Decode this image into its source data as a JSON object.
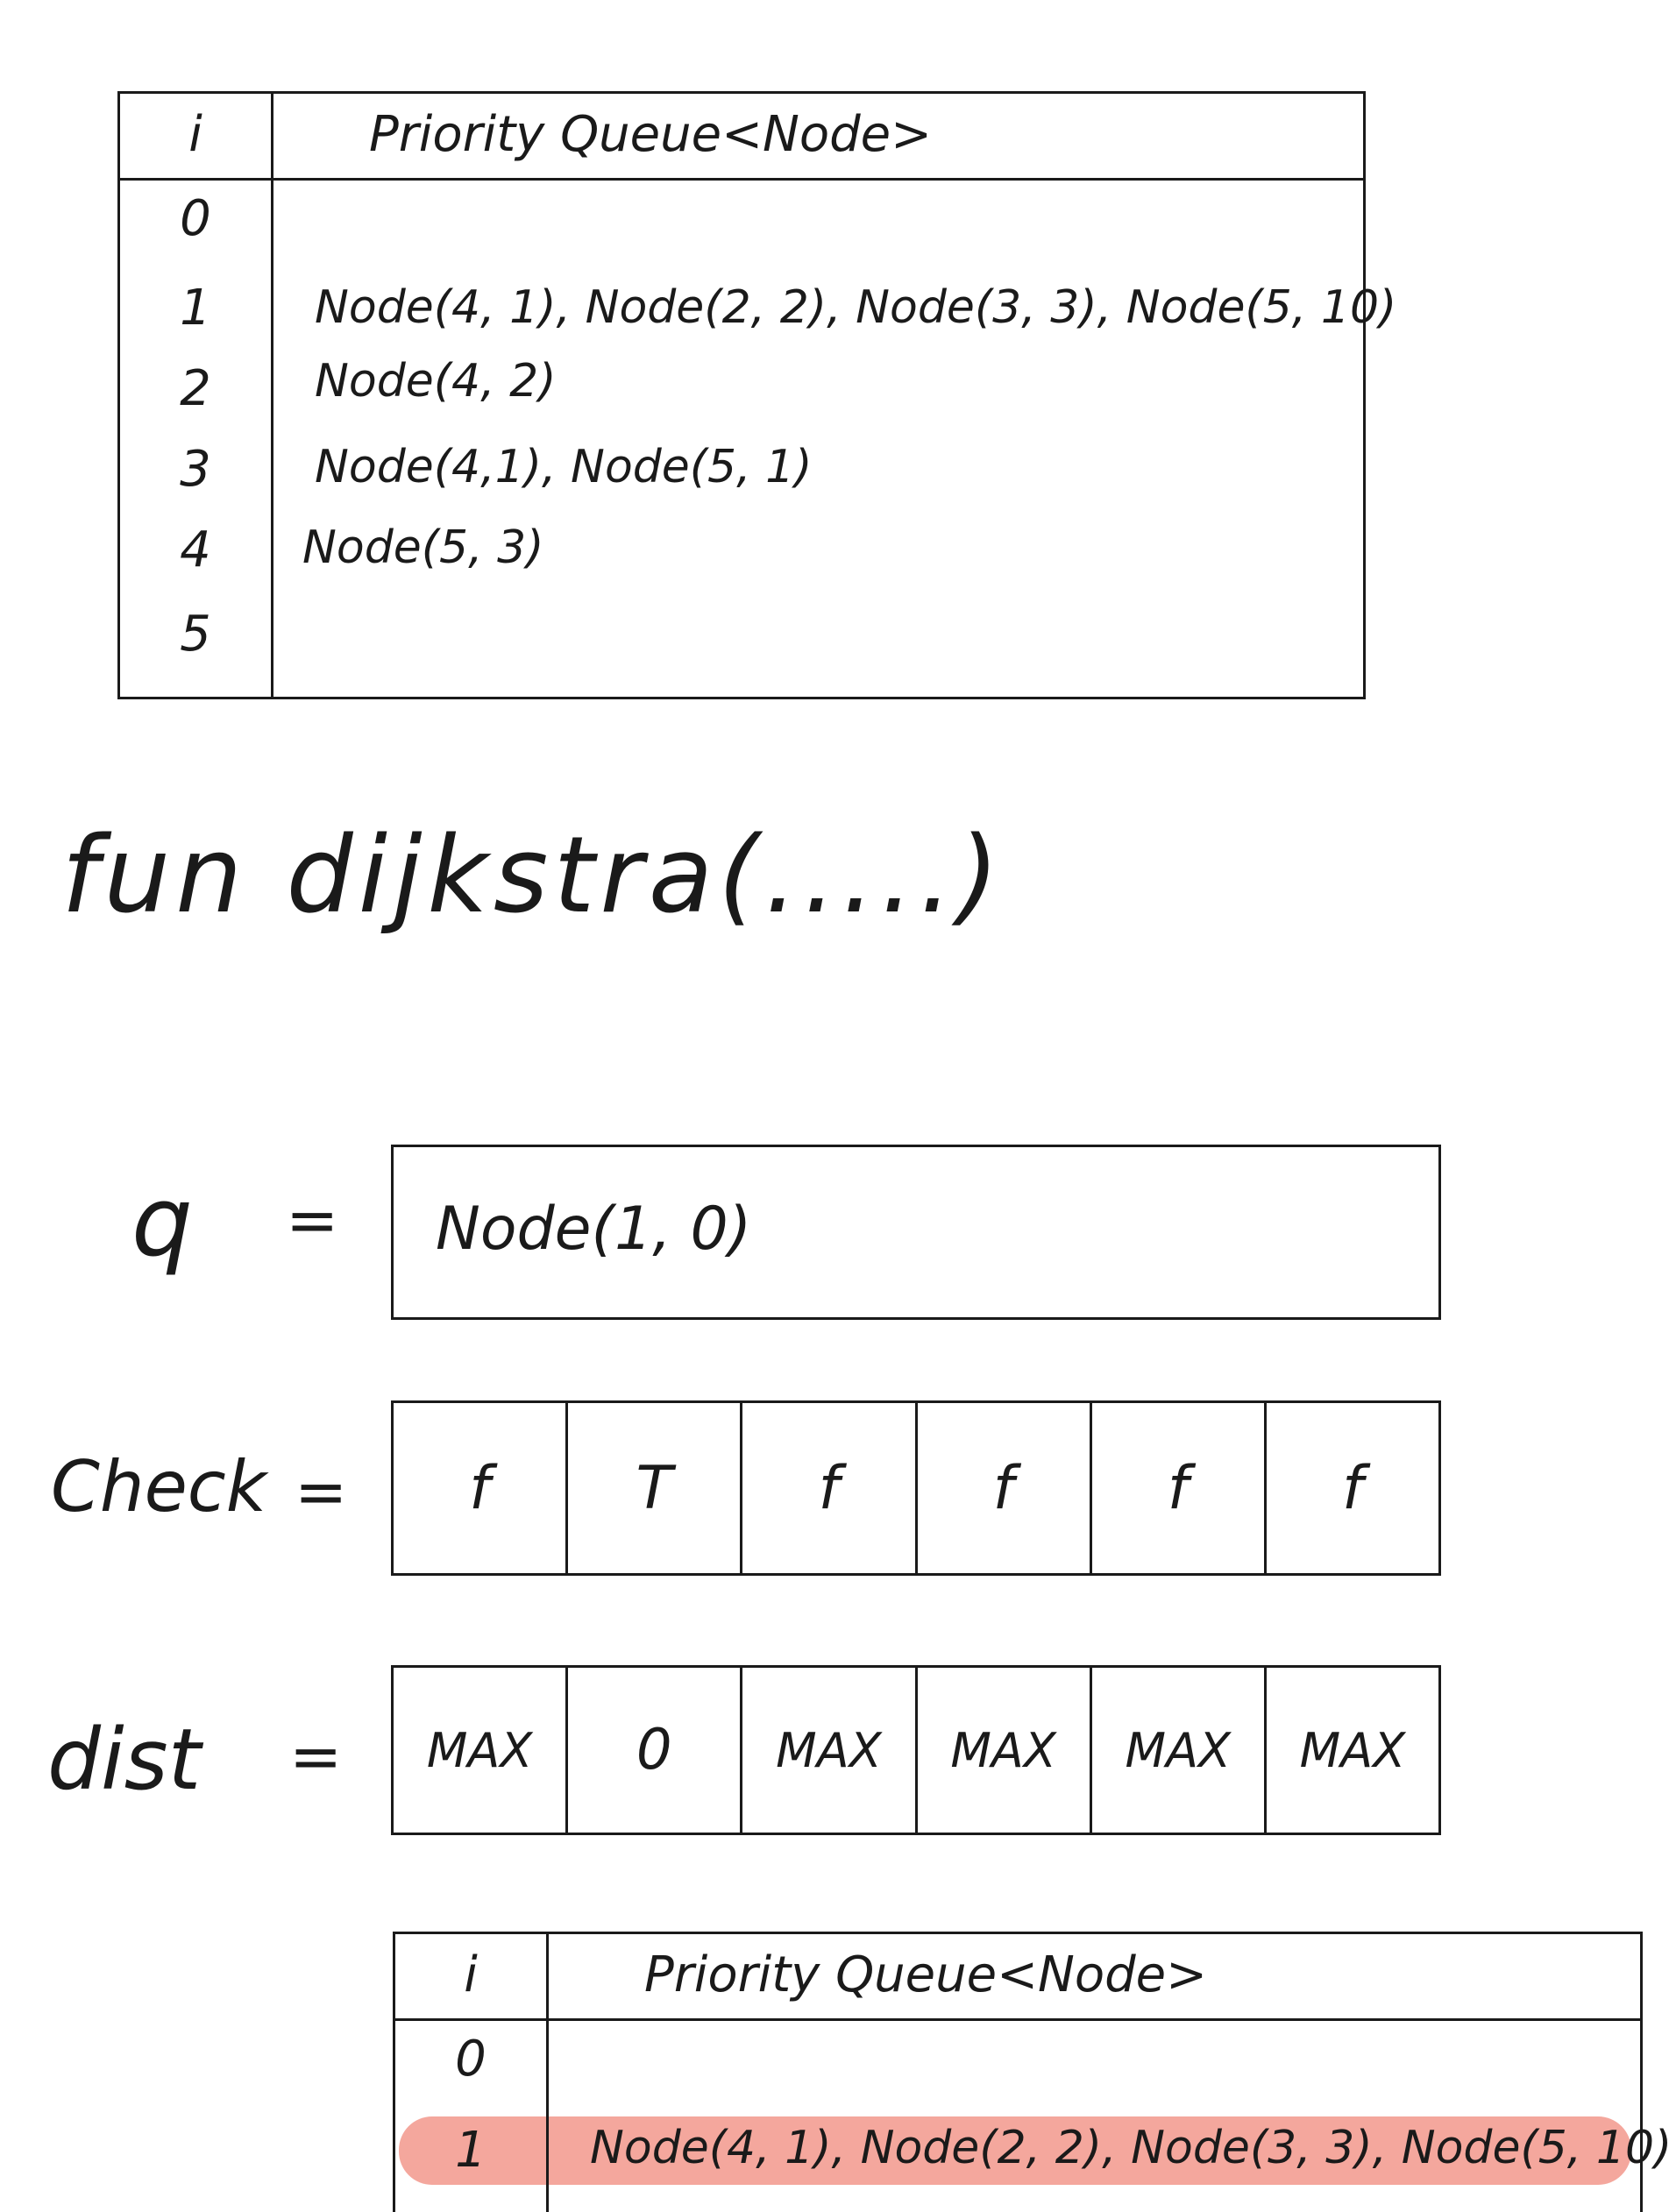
{
  "tables": [
    {
      "index_header": "i",
      "header": "Priority Queue<Node>",
      "rows": [
        {
          "index": "0",
          "value": ""
        },
        {
          "index": "1",
          "value": "Node(4, 1), Node(2, 2), Node(3, 3), Node(5, 10)"
        },
        {
          "index": "2",
          "value": "Node(4, 2)"
        },
        {
          "index": "3",
          "value": "Node(4,1), Node(5, 1)"
        },
        {
          "index": "4",
          "value": "Node(5, 3)"
        },
        {
          "index": "5",
          "value": ""
        }
      ]
    },
    {
      "index_header": "i",
      "header": "Priority Queue<Node>",
      "rows": [
        {
          "index": "0",
          "value": ""
        },
        {
          "index": "1",
          "value": "Node(4, 1), Node(2, 2), Node(3, 3), Node(5, 10)"
        }
      ],
      "highlight_color": "#f4a79d"
    }
  ],
  "function_title": "fun dijkstra(.....)",
  "q": {
    "label": "q",
    "equals": "=",
    "value": "Node(1, 0)"
  },
  "check": {
    "label": "Check",
    "equals": "=",
    "cells": [
      "f",
      "T",
      "f",
      "f",
      "f",
      "f"
    ]
  },
  "dist": {
    "label": "dist",
    "equals": "=",
    "cells": [
      "MAX",
      "0",
      "MAX",
      "MAX",
      "MAX",
      "MAX"
    ]
  }
}
